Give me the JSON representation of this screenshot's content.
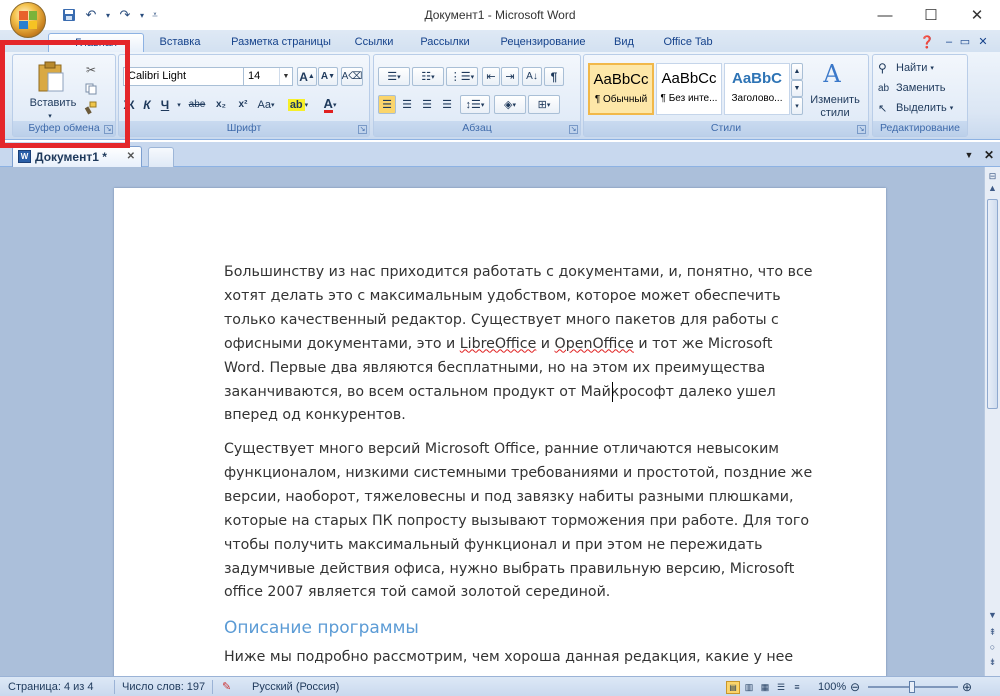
{
  "window": {
    "title": "Документ1 - Microsoft Word",
    "minimize": "—",
    "maximize": "☐",
    "close": "✕"
  },
  "ribbon_tabs": [
    {
      "label": "Главная"
    },
    {
      "label": "Вставка"
    },
    {
      "label": "Разметка страницы"
    },
    {
      "label": "Ссылки"
    },
    {
      "label": "Рассылки"
    },
    {
      "label": "Рецензирование"
    },
    {
      "label": "Вид"
    },
    {
      "label": "Office Tab"
    }
  ],
  "clipboard": {
    "paste_label": "Вставить",
    "group_label": "Буфер обмена"
  },
  "font": {
    "family": "Calibri Light",
    "size": "14",
    "group_label": "Шрифт",
    "bold": "Ж",
    "italic": "К",
    "underline": "Ч",
    "strike": "abe",
    "subscript": "x₂",
    "superscript": "x²",
    "case": "Aa",
    "grow": "A",
    "shrink": "A"
  },
  "paragraph": {
    "group_label": "Абзац"
  },
  "styles": {
    "group_label": "Стили",
    "items": [
      {
        "sample": "AaBbCc",
        "name": "¶ Обычный"
      },
      {
        "sample": "AaBbCc",
        "name": "¶ Без инте..."
      },
      {
        "sample": "AaBbC",
        "name": "Заголово..."
      }
    ],
    "change_label_1": "Изменить",
    "change_label_2": "стили"
  },
  "editing": {
    "group_label": "Редактирование",
    "find": "Найти",
    "replace": "Заменить",
    "select": "Выделить"
  },
  "doc_tab": {
    "label": "Документ1 *",
    "close": "✕"
  },
  "document": {
    "paragraphs": [
      [
        "Большинству из нас приходится работать с документами, и, понятно, что все",
        "хотят делать это с максимальным удобством, которое может обеспечить",
        "только качественный редактор. Существует много пакетов для работы с"
      ],
      [
        "Word. Первые два являются бесплатными, но на этом их преимущества",
        "заканчиваются, во всем остальном продукт от Майкрософт далеко ушел",
        "вперед од конкурентов."
      ],
      [
        "Существует много версий Microsoft Office, ранние отличаются невысоким",
        "функционалом, низкими системными требованиями и простотой, поздние же",
        "версии, наоборот, тяжеловесны и под завязку набиты разными плюшками,",
        "которые на старых ПК попросту вызывают торможения при работе. Для того",
        "чтобы получить максимальный функционал и при этом не пережидать",
        "задумчивые действия офиса, нужно выбрать правильную версию, Microsoft",
        "office 2007 является той самой золотой серединой."
      ]
    ],
    "line4": {
      "a": "офисными документами, это и ",
      "b": "LibreOffice",
      "c": " и ",
      "d": "OpenOffice",
      "e": " и тот же Microsoft"
    },
    "heading": "Описание программы",
    "last_line": "Ниже мы подробно рассмотрим, чем хороша данная редакция, какие у нее"
  },
  "statusbar": {
    "page": "Страница: 4 из 4",
    "words": "Число слов: 197",
    "language": "Русский (Россия)",
    "zoom": "100%"
  },
  "colors": {
    "accent_red": "#e4262a",
    "heading": "#5b9bd5",
    "ribbon": "#dbe6f4"
  }
}
